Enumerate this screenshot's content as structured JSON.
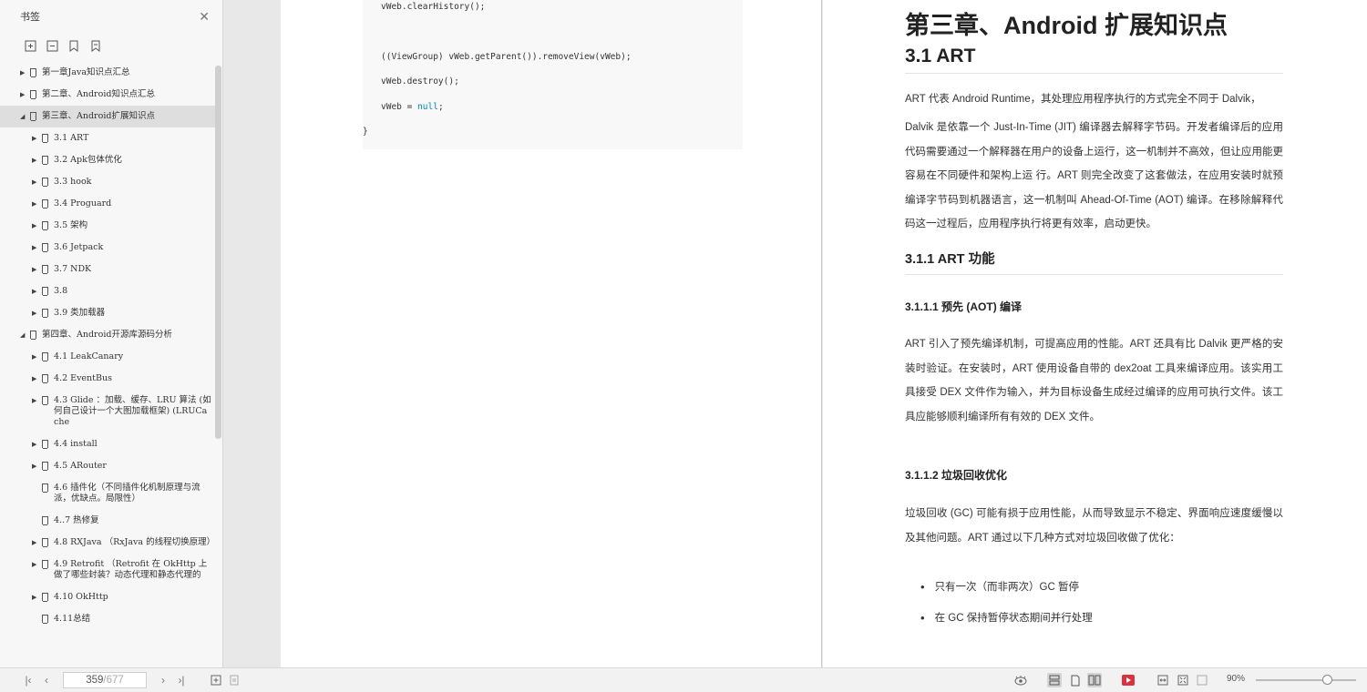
{
  "sidebar": {
    "title": "书签",
    "items": [
      {
        "label": "第一章Java知识点汇总",
        "level": 1,
        "twisty": "▶"
      },
      {
        "label": "第二章、Android知识点汇总",
        "level": 1,
        "twisty": "▶"
      },
      {
        "label": "第三章、Android扩展知识点",
        "level": 1,
        "twisty": "◢",
        "selected": true
      },
      {
        "label": "3.1 ART",
        "level": 2,
        "twisty": "▶"
      },
      {
        "label": "3.2 Apk包体优化",
        "level": 2,
        "twisty": "▶"
      },
      {
        "label": "3.3 hook",
        "level": 2,
        "twisty": "▶"
      },
      {
        "label": "3.4 Proguard",
        "level": 2,
        "twisty": "▶"
      },
      {
        "label": "3.5 架构",
        "level": 2,
        "twisty": "▶"
      },
      {
        "label": "3.6 Jetpack",
        "level": 2,
        "twisty": "▶"
      },
      {
        "label": "3.7 NDK",
        "level": 2,
        "twisty": "▶"
      },
      {
        "label": "3.8",
        "level": 2,
        "twisty": "▶"
      },
      {
        "label": "3.9 类加载器",
        "level": 2,
        "twisty": "▶"
      },
      {
        "label": "第四章、Android开源库源码分析",
        "level": 1,
        "twisty": "◢"
      },
      {
        "label": "4.1 LeakCanary",
        "level": 2,
        "twisty": "▶"
      },
      {
        "label": "4.2 EventBus",
        "level": 2,
        "twisty": "▶"
      },
      {
        "label": "4.3 Glide ：加载、缓存、LRU 算法 (如何自己设计一个大图加载框架) (LRUCache",
        "level": 2,
        "twisty": "▶"
      },
      {
        "label": "4.4 install",
        "level": 2,
        "twisty": "▶"
      },
      {
        "label": "4.5 ARouter",
        "level": 2,
        "twisty": "▶"
      },
      {
        "label": "4.6 插件化（不同插件化机制原理与流派，优缺点。局限性）",
        "level": 2,
        "twisty": ""
      },
      {
        "label": "4..7 热修复",
        "level": 2,
        "twisty": ""
      },
      {
        "label": "4.8 RXJava （RxJava 的线程切换原理）",
        "level": 2,
        "twisty": "▶"
      },
      {
        "label": "4.9 Retrofit （Retrofit 在 OkHttp 上做了哪些封装？动态代理和静态代理的",
        "level": 2,
        "twisty": "▶"
      },
      {
        "label": "4.10 OkHttp",
        "level": 2,
        "twisty": "▶"
      },
      {
        "label": "4.11总结",
        "level": 2,
        "twisty": ""
      }
    ]
  },
  "left_page": {
    "code_lines": [
      "vWeb.clearHistory();",
      "((ViewGroup) vWeb.getParent()).removeView(vWeb);",
      "vWeb.destroy();",
      "vWeb = ",
      "null",
      ";",
      "}"
    ]
  },
  "right_page": {
    "h1": "第三章、Android 扩展知识点",
    "h2": "3.1 ART",
    "p1_line1": "ART 代表 Android Runtime，其处理应用程序执行的方式完全不同于 Dalvik，",
    "p2": "Dalvik 是依靠一个 Just-In-Time (JIT) 编译器去解释字节码。开发者编译后的应用代码需要通过一个解释器在用户的设备上运行，这一机制并不高效，但让应用能更容易在不同硬件和架构上运 行。ART 则完全改变了这套做法，在应用安装时就预编译字节码到机器语言，这一机制叫 Ahead-Of-Time (AOT) 编译。在移除解释代码这一过程后，应用程序执行将更有效率，启动更快。",
    "h3": "3.1.1 ART  功能",
    "h4a": "3.1.1.1  预先 (AOT) 编译",
    "p3": "ART 引入了预先编译机制，可提高应用的性能。ART 还具有比 Dalvik 更严格的安装时验证。在安装时，ART 使用设备自带的 dex2oat 工具来编译应用。该实用工具接受 DEX 文件作为输入，并为目标设备生成经过编译的应用可执行文件。该工具应能够顺利编译所有有效的 DEX 文件。",
    "h4b": "3.1.1.2  垃圾回收优化",
    "p4": "垃圾回收 (GC) 可能有损于应用性能，从而导致显示不稳定、界面响应速度缓慢以及其他问题。ART 通过以下几种方式对垃圾回收做了优化：",
    "bullets": [
      "只有一次（而非两次）GC 暂停",
      "在 GC 保持暂停状态期间并行处理"
    ]
  },
  "statusbar": {
    "current_page": "359",
    "total_pages": "/677",
    "zoom": "90%"
  }
}
